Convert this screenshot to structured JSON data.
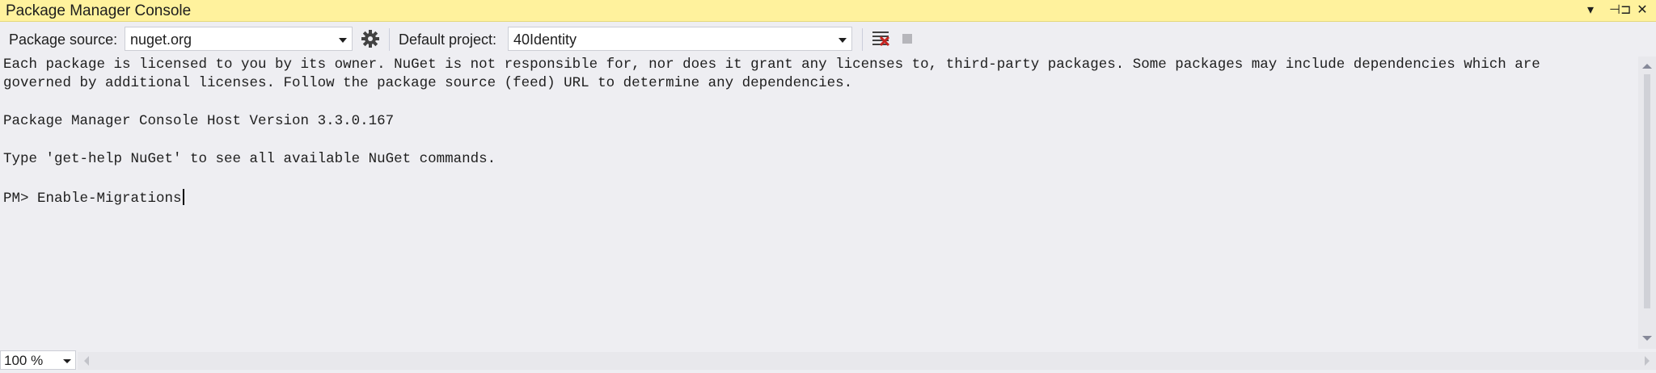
{
  "window": {
    "title": "Package Manager Console",
    "controls": {
      "dropdown": "▾",
      "pin": "⊣⊐",
      "close": "✕"
    }
  },
  "toolbar": {
    "package_source_label": "Package source:",
    "package_source_value": "nuget.org",
    "default_project_label": "Default project:",
    "default_project_value": "40Identity",
    "icons": [
      "settings-gear-icon",
      "clear-console-icon",
      "stop-icon"
    ]
  },
  "console": {
    "lines": [
      "Each package is licensed to you by its owner. NuGet is not responsible for, nor does it grant any licenses to, third-party packages. Some packages may include dependencies which are",
      "governed by additional licenses. Follow the package source (feed) URL to determine any dependencies.",
      "Package Manager Console Host Version 3.3.0.167",
      "Type 'get-help NuGet' to see all available NuGet commands.",
      "PM> Enable-Migrations"
    ]
  },
  "statusbar": {
    "zoom": "100 %"
  },
  "colors": {
    "title_bar": "#fff29d",
    "background": "#eeeef2",
    "text": "#1e1e1e"
  }
}
